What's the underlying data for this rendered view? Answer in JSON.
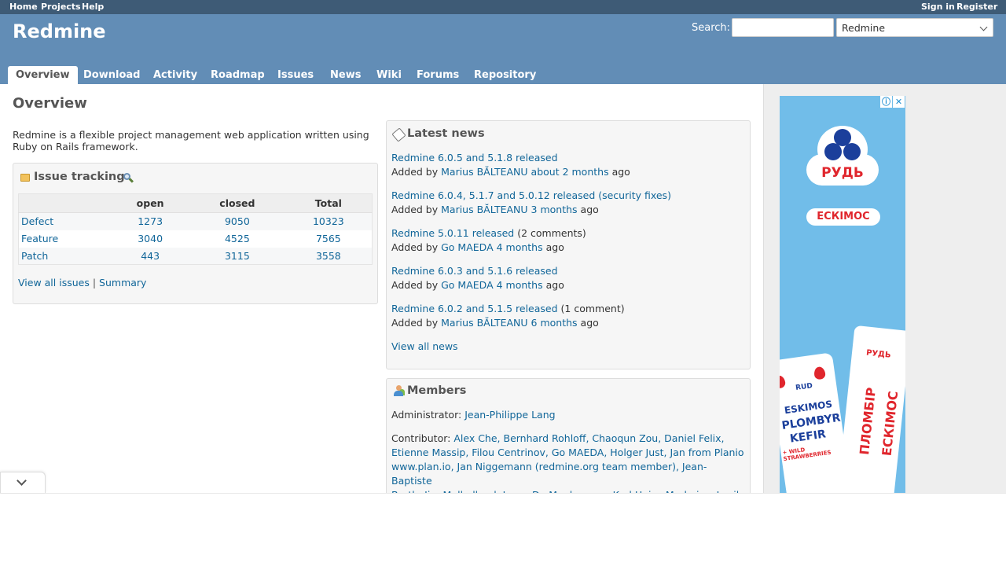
{
  "top_menu": {
    "home": "Home",
    "projects": "Projects",
    "help": "Help",
    "sign_in": "Sign in",
    "register": "Register"
  },
  "header": {
    "title": "Redmine",
    "search_label": "Search:",
    "search_value": "",
    "project_select": "Redmine"
  },
  "tabs": {
    "overview": "Overview",
    "download": "Download",
    "activity": "Activity",
    "roadmap": "Roadmap",
    "issues": "Issues",
    "news": "News",
    "wiki": "Wiki",
    "forums": "Forums",
    "repository": "Repository"
  },
  "content": {
    "page_title": "Overview",
    "description_line1": "Redmine is a flexible project management web application written using",
    "description_line2": "Ruby on Rails framework."
  },
  "issue_tracking": {
    "title": "Issue tracking",
    "headers": [
      "",
      "open",
      "closed",
      "Total"
    ],
    "rows": [
      {
        "tracker": "Defect",
        "open": "1273",
        "closed": "9050",
        "total": "10323"
      },
      {
        "tracker": "Feature",
        "open": "3040",
        "closed": "4525",
        "total": "7565"
      },
      {
        "tracker": "Patch",
        "open": "443",
        "closed": "3115",
        "total": "3558"
      }
    ],
    "view_all": "View all issues",
    "separator": "|",
    "summary": "Summary"
  },
  "latest_news": {
    "title": "Latest news",
    "added_by": "Added by",
    "ago": "ago",
    "items": [
      {
        "title": "Redmine 6.0.5 and 5.1.8 released",
        "comments": "",
        "author": "Marius BĂLTEANU",
        "time": "about 2 months"
      },
      {
        "title": "Redmine 6.0.4, 5.1.7 and 5.0.12 released (security fixes)",
        "comments": "",
        "author": "Marius BĂLTEANU",
        "time": "3 months"
      },
      {
        "title": "Redmine 5.0.11 released",
        "comments": "(2 comments)",
        "author": "Go MAEDA",
        "time": "4 months"
      },
      {
        "title": "Redmine 6.0.3 and 5.1.6 released",
        "comments": "",
        "author": "Go MAEDA",
        "time": "4 months"
      },
      {
        "title": "Redmine 6.0.2 and 5.1.5 released",
        "comments": "(1 comment)",
        "author": "Marius BĂLTEANU",
        "time": "6 months"
      }
    ],
    "view_all": "View all news"
  },
  "members": {
    "title": "Members",
    "admin_label": "Administrator:",
    "admin_name": "Jean-Philippe Lang",
    "contributor_label": "Contributor:",
    "contributors_line1": "Alex Che, Bernhard Rohloff, Chaoqun Zou, Daniel Felix,",
    "contributors_line2": "Etienne Massip, Filou Centrinov, Go MAEDA, Holger Just, Jan from Planio",
    "contributors_line3": "www.plan.io, Jan Niggemann (redmine.org team member), Jean-Baptiste",
    "contributors_line4": "Barth, Jim Mulholland, Jonas De Meulenaere, Karl Heinz Marbaise, Lucile"
  },
  "ad": {
    "info": "ⓘ",
    "close": "✕",
    "brand": "РУДЬ",
    "badge": "ЕСКІМОС",
    "left_pack_brand": "RUD",
    "left_pack_line1": "ESKIMOS",
    "left_pack_line2": "PLOMBYR",
    "left_pack_line3": "KEFIR",
    "left_pack_line4": "+ WILD STRAWBERRIES",
    "right_pack_brand": "РУДЬ",
    "right_pack_line1": "ПЛОМБІР",
    "right_pack_line2": "ЕСКІМОС"
  },
  "icons": {
    "issue_tracking": "folder-icon",
    "zoom": "zoom-icon",
    "news": "news-icon",
    "members": "group-icon",
    "collapse": "chevron-down-icon"
  },
  "colors": {
    "header_bg": "#628db6",
    "top_menu_bg": "#3e5b76",
    "link": "#169",
    "box_bg": "#f6f6f6",
    "sidebar_bg": "#eeeeee",
    "ad_bg": "#71bde9",
    "brand_red": "#e0262d",
    "brand_blue": "#1b3f9b"
  }
}
